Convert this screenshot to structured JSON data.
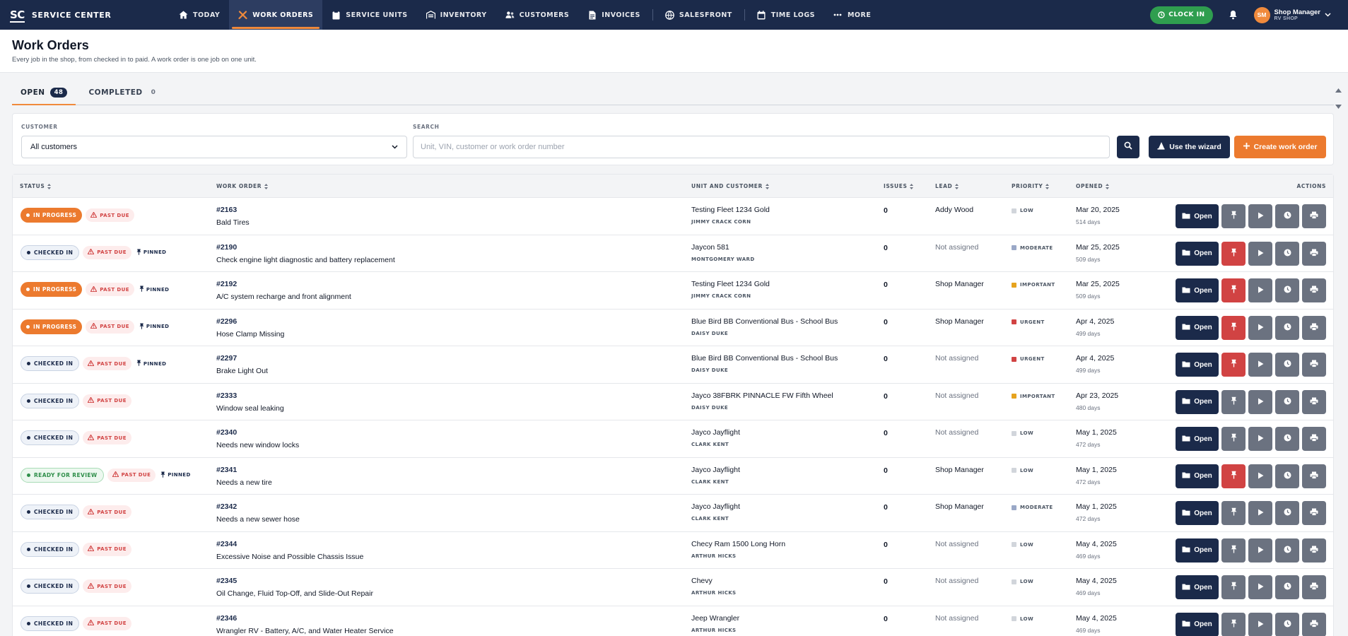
{
  "app": {
    "logo": "SC",
    "name": "SERVICE CENTER"
  },
  "nav": [
    {
      "label": "TODAY",
      "icon": "home-icon"
    },
    {
      "label": "WORK ORDERS",
      "icon": "tools-icon",
      "active": true
    },
    {
      "label": "SERVICE UNITS",
      "icon": "clipboard-icon"
    },
    {
      "label": "INVENTORY",
      "icon": "warehouse-icon"
    },
    {
      "label": "CUSTOMERS",
      "icon": "users-icon"
    },
    {
      "label": "INVOICES",
      "icon": "invoice-icon"
    },
    {
      "label": "SALESFRONT",
      "icon": "globe-icon"
    },
    {
      "label": "TIME LOGS",
      "icon": "calendar-icon"
    },
    {
      "label": "MORE",
      "icon": "more-icon"
    }
  ],
  "header_right": {
    "clock_in": "CLOCK IN",
    "avatar": "SM",
    "user_name": "Shop Manager",
    "user_sub": "RV SHOP"
  },
  "page": {
    "title": "Work Orders",
    "subtitle": "Every job in the shop, from checked in to paid. A work order is one job on one unit."
  },
  "tabs": [
    {
      "label": "OPEN",
      "count": "48",
      "active": true
    },
    {
      "label": "COMPLETED",
      "count": "0"
    }
  ],
  "filters": {
    "customer_label": "CUSTOMER",
    "customer_value": "All customers",
    "search_label": "SEARCH",
    "search_placeholder": "Unit, VIN, customer or work order number",
    "wizard_label": "Use the wizard",
    "create_label": "Create work order"
  },
  "columns": [
    "STATUS",
    "WORK ORDER",
    "UNIT AND CUSTOMER",
    "ISSUES",
    "LEAD",
    "PRIORITY",
    "OPENED",
    "ACTIONS"
  ],
  "colors": {
    "navy": "#1b2a4a",
    "orange": "#ec7a2e",
    "danger": "#d14343",
    "green": "#2f9e4f"
  },
  "action_open_label": "Open",
  "rows": [
    {
      "status": "IN PROGRESS",
      "status_kind": "progress",
      "past_due": "PAST DUE",
      "pinned": "",
      "num": "#2163",
      "desc": "Bald Tires",
      "unit": "Testing Fleet 1234 Gold",
      "customer": "JIMMY CRACK CORN",
      "issues": "0",
      "lead": "Addy Wood",
      "priority": "LOW",
      "opened": "Mar 20, 2025",
      "days": "514 days"
    },
    {
      "status": "CHECKED IN",
      "status_kind": "checked",
      "past_due": "PAST DUE",
      "pinned": "PINNED",
      "num": "#2190",
      "desc": "Check engine light diagnostic and battery replacement",
      "unit": "Jaycon 581",
      "customer": "MONTGOMERY WARD",
      "issues": "0",
      "lead": "Not assigned",
      "priority": "MODERATE",
      "opened": "Mar 25, 2025",
      "days": "509 days"
    },
    {
      "status": "IN PROGRESS",
      "status_kind": "progress",
      "past_due": "PAST DUE",
      "pinned": "PINNED",
      "num": "#2192",
      "desc": "A/C system recharge and front alignment",
      "unit": "Testing Fleet 1234 Gold",
      "customer": "JIMMY CRACK CORN",
      "issues": "0",
      "lead": "Shop Manager",
      "priority": "IMPORTANT",
      "opened": "Mar 25, 2025",
      "days": "509 days"
    },
    {
      "status": "IN PROGRESS",
      "status_kind": "progress",
      "past_due": "PAST DUE",
      "pinned": "PINNED",
      "num": "#2296",
      "desc": "Hose Clamp Missing",
      "unit": "Blue Bird BB Conventional Bus - School Bus",
      "customer": "DAISY DUKE",
      "issues": "0",
      "lead": "Shop Manager",
      "priority": "URGENT",
      "opened": "Apr 4, 2025",
      "days": "499 days"
    },
    {
      "status": "CHECKED IN",
      "status_kind": "checked",
      "past_due": "PAST DUE",
      "pinned": "PINNED",
      "num": "#2297",
      "desc": "Brake Light Out",
      "unit": "Blue Bird BB Conventional Bus - School Bus",
      "customer": "DAISY DUKE",
      "issues": "0",
      "lead": "Not assigned",
      "priority": "URGENT",
      "opened": "Apr 4, 2025",
      "days": "499 days"
    },
    {
      "status": "CHECKED IN",
      "status_kind": "checked",
      "past_due": "PAST DUE",
      "pinned": "",
      "num": "#2333",
      "desc": "Window seal leaking",
      "unit": "Jayco 38FBRK PINNACLE FW Fifth Wheel",
      "customer": "DAISY DUKE",
      "issues": "0",
      "lead": "Not assigned",
      "priority": "IMPORTANT",
      "opened": "Apr 23, 2025",
      "days": "480 days"
    },
    {
      "status": "CHECKED IN",
      "status_kind": "checked",
      "past_due": "PAST DUE",
      "pinned": "",
      "num": "#2340",
      "desc": "Needs new window locks",
      "unit": "Jayco Jayflight",
      "customer": "CLARK KENT",
      "issues": "0",
      "lead": "Not assigned",
      "priority": "LOW",
      "opened": "May 1, 2025",
      "days": "472 days"
    },
    {
      "status": "READY FOR REVIEW",
      "status_kind": "review",
      "past_due": "PAST DUE",
      "pinned": "PINNED",
      "num": "#2341",
      "desc": "Needs a new tire",
      "unit": "Jayco Jayflight",
      "customer": "CLARK KENT",
      "issues": "0",
      "lead": "Shop Manager",
      "priority": "LOW",
      "opened": "May 1, 2025",
      "days": "472 days"
    },
    {
      "status": "CHECKED IN",
      "status_kind": "checked",
      "past_due": "PAST DUE",
      "pinned": "",
      "num": "#2342",
      "desc": "Needs a new sewer hose",
      "unit": "Jayco Jayflight",
      "customer": "CLARK KENT",
      "issues": "0",
      "lead": "Shop Manager",
      "priority": "MODERATE",
      "opened": "May 1, 2025",
      "days": "472 days"
    },
    {
      "status": "CHECKED IN",
      "status_kind": "checked",
      "past_due": "PAST DUE",
      "pinned": "",
      "num": "#2344",
      "desc": "Excessive Noise and Possible Chassis Issue",
      "unit": "Checy Ram 1500 Long Horn",
      "customer": "ARTHUR HICKS",
      "issues": "0",
      "lead": "Not assigned",
      "priority": "LOW",
      "opened": "May 4, 2025",
      "days": "469 days"
    },
    {
      "status": "CHECKED IN",
      "status_kind": "checked",
      "past_due": "PAST DUE",
      "pinned": "",
      "num": "#2345",
      "desc": "Oil Change, Fluid Top-Off, and Slide-Out Repair",
      "unit": "Chevy",
      "customer": "ARTHUR HICKS",
      "issues": "0",
      "lead": "Not assigned",
      "priority": "LOW",
      "opened": "May 4, 2025",
      "days": "469 days"
    },
    {
      "status": "CHECKED IN",
      "status_kind": "checked",
      "past_due": "PAST DUE",
      "pinned": "",
      "num": "#2346",
      "desc": "Wrangler RV - Battery, A/C, and Water Heater Service",
      "unit": "Jeep Wrangler",
      "customer": "ARTHUR HICKS",
      "issues": "0",
      "lead": "Not assigned",
      "priority": "LOW",
      "opened": "May 4, 2025",
      "days": "469 days"
    }
  ]
}
